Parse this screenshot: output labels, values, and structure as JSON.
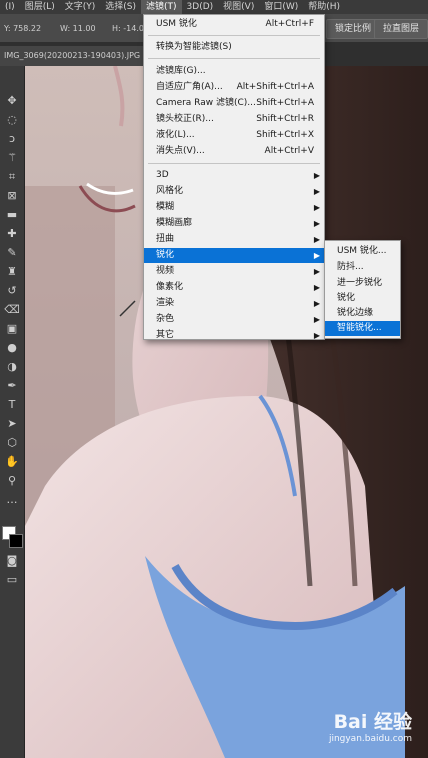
{
  "menubar": {
    "items": [
      {
        "label": "(I)",
        "active": false
      },
      {
        "label": "图层(L)",
        "active": false
      },
      {
        "label": "文字(Y)",
        "active": false
      },
      {
        "label": "选择(S)",
        "active": false
      },
      {
        "label": "滤镜(T)",
        "active": true
      },
      {
        "label": "3D(D)",
        "active": false
      },
      {
        "label": "视图(V)",
        "active": false
      },
      {
        "label": "窗口(W)",
        "active": false
      },
      {
        "label": "帮助(H)",
        "active": false
      }
    ]
  },
  "optbar": {
    "x": "Y: 758.22",
    "w": "W: 11.00",
    "h": "H: -14.00",
    "btn1": "锁定比例",
    "btn2": "拉直图层"
  },
  "doc": {
    "tab": "IMG_3069(20200213-190403).JPG"
  },
  "filter_menu": {
    "rows": [
      {
        "label": "USM 锐化",
        "shortcut": "Alt+Ctrl+F"
      },
      {
        "label": "转换为智能滤镜(S)",
        "shortcut": ""
      },
      {
        "label": "滤镜库(G)...",
        "shortcut": ""
      },
      {
        "label": "自适应广角(A)...",
        "shortcut": "Alt+Shift+Ctrl+A"
      },
      {
        "label": "Camera Raw 滤镜(C)...",
        "shortcut": "Shift+Ctrl+A"
      },
      {
        "label": "镜头校正(R)...",
        "shortcut": "Shift+Ctrl+R"
      },
      {
        "label": "液化(L)...",
        "shortcut": "Shift+Ctrl+X"
      },
      {
        "label": "消失点(V)...",
        "shortcut": "Alt+Ctrl+V"
      },
      {
        "label": "3D"
      },
      {
        "label": "风格化"
      },
      {
        "label": "模糊"
      },
      {
        "label": "模糊画廊"
      },
      {
        "label": "扭曲"
      },
      {
        "label": "锐化"
      },
      {
        "label": "视频"
      },
      {
        "label": "像素化"
      },
      {
        "label": "渲染"
      },
      {
        "label": "杂色"
      },
      {
        "label": "其它"
      }
    ]
  },
  "sharpen_submenu": {
    "items": [
      "USM 锐化...",
      "防抖...",
      "进一步锐化",
      "锐化",
      "锐化边缘",
      "智能锐化..."
    ]
  },
  "watermark": {
    "brand": "Bai  经验",
    "url": "jingyan.baidu.com"
  },
  "icons": {
    "arrow": "▶"
  },
  "colors": {
    "highlight": "#0a72d6",
    "menu_bg": "#f0f0f0",
    "dress": "#7aa3dd"
  }
}
